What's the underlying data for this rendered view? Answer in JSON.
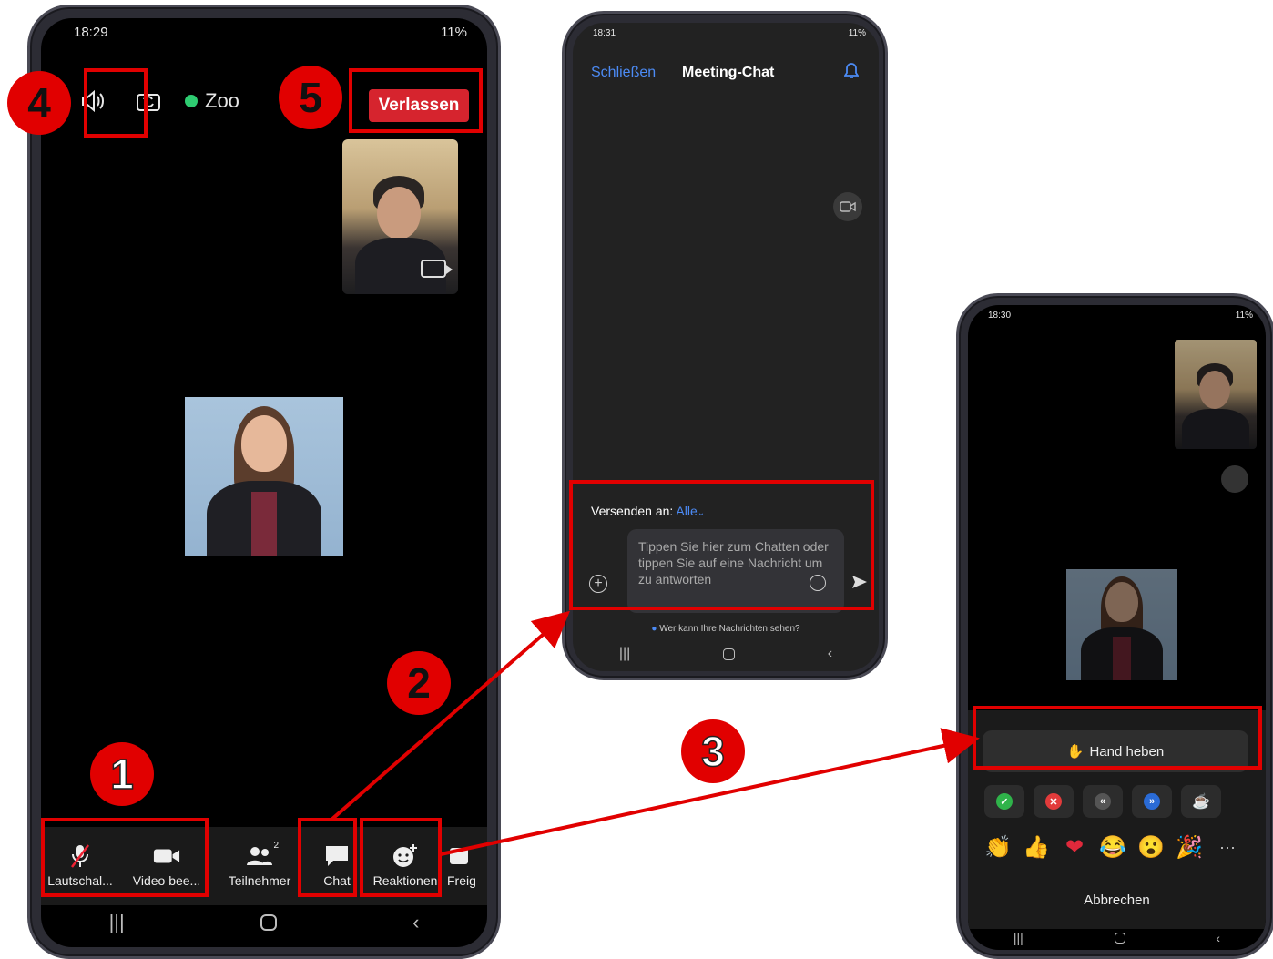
{
  "phone1": {
    "status_time": "18:29",
    "battery": "11%",
    "meeting_title_partial": "Zoo",
    "leave_label": "Verlassen",
    "toolbar": [
      {
        "key": "mute",
        "label": "Lautschal..."
      },
      {
        "key": "video",
        "label": "Video bee..."
      },
      {
        "key": "participants",
        "label": "Teilnehmer",
        "count": "2"
      },
      {
        "key": "chat",
        "label": "Chat"
      },
      {
        "key": "reactions",
        "label": "Reaktionen"
      },
      {
        "key": "share",
        "label": "Freig"
      }
    ]
  },
  "phone2": {
    "status_time": "18:31",
    "battery": "11%",
    "close_label": "Schließen",
    "title": "Meeting-Chat",
    "send_to_label": "Versenden an:",
    "send_to_value": "Alle",
    "input_placeholder": "Tippen Sie hier zum Chatten oder tippen Sie auf eine Nachricht um zu antworten",
    "visibility_hint": "Wer kann Ihre Nachrichten sehen?"
  },
  "phone3": {
    "status_time": "18:30",
    "battery": "11%",
    "raise_hand_label": "Hand heben",
    "cancel_label": "Abbrechen"
  },
  "annotations": [
    "1",
    "2",
    "3",
    "4",
    "5"
  ],
  "colors": {
    "annotation_red": "#e10000",
    "leave_red": "#d6242e",
    "link_blue": "#4c8bf5"
  }
}
